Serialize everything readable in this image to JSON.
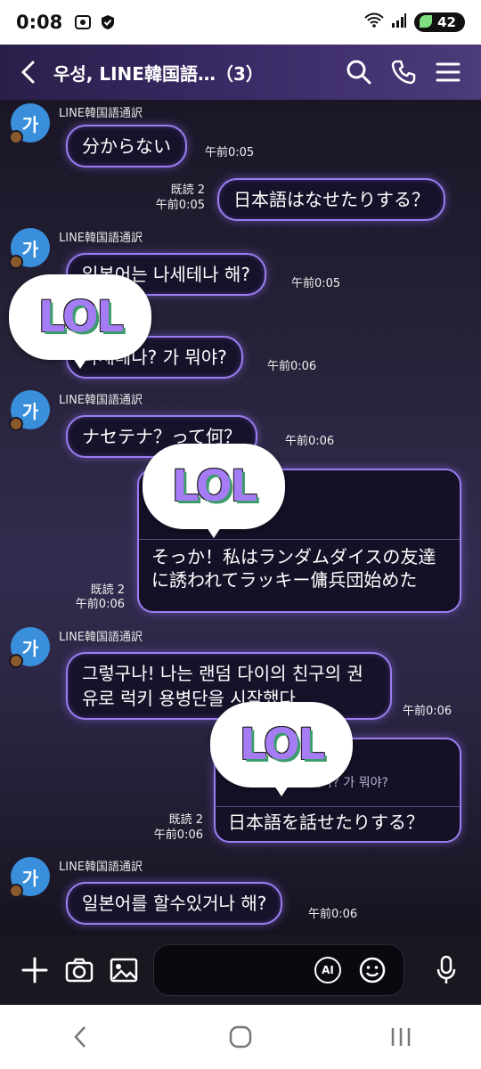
{
  "status": {
    "time": "0:08",
    "battery": "42"
  },
  "header": {
    "title": "우성, LINE韓国語…（3）"
  },
  "messages": {
    "m1": {
      "text": "分からない",
      "time": "午前0:05"
    },
    "m2": {
      "text": "日本語はなせたりする？",
      "read": "既読 2",
      "time": "午前0:05"
    },
    "sender2": "LINE韓国語通訳",
    "m3": {
      "text": "일본어는 나세테나 해?",
      "time": "午前0:05"
    },
    "m4": {
      "text": "나세테나? 가 뭐야?",
      "time": "午前0:06"
    },
    "sender3": "LINE韓国語通訳",
    "m5": {
      "text": "ナセテナ？って何？",
      "time": "午前0:06"
    },
    "m6": {
      "text": "そっか！私はランダムダイスの友達に誘われてラッキー傭兵団始めた",
      "read": "既読 2",
      "time": "午前0:06"
    },
    "sender4": "LINE韓国語通訳",
    "m7": {
      "text": "그렇구나! 나는 랜덤 다이의 친구의 권유로 럭키 용병단을 시작했다",
      "time": "午前0:06"
    },
    "m8": {
      "quote": "나세테나? 가 뭐야?",
      "text": "日本語を話せたりする？",
      "read": "既読 2",
      "time": "午前0:06"
    },
    "sender5": "LINE韓国語通訳",
    "m9": {
      "text": "일본어를 할수있거나 해?",
      "time": "午前0:06"
    },
    "sender1": "LINE韓国語通訳"
  },
  "stickers": {
    "lol": "LOL"
  },
  "avatar_glyph": "가",
  "input": {
    "ai_label": "AI",
    "placeholder": ""
  },
  "colors": {
    "bubble_border": "#9b7df0",
    "accent_lol": "#a57cf6"
  }
}
